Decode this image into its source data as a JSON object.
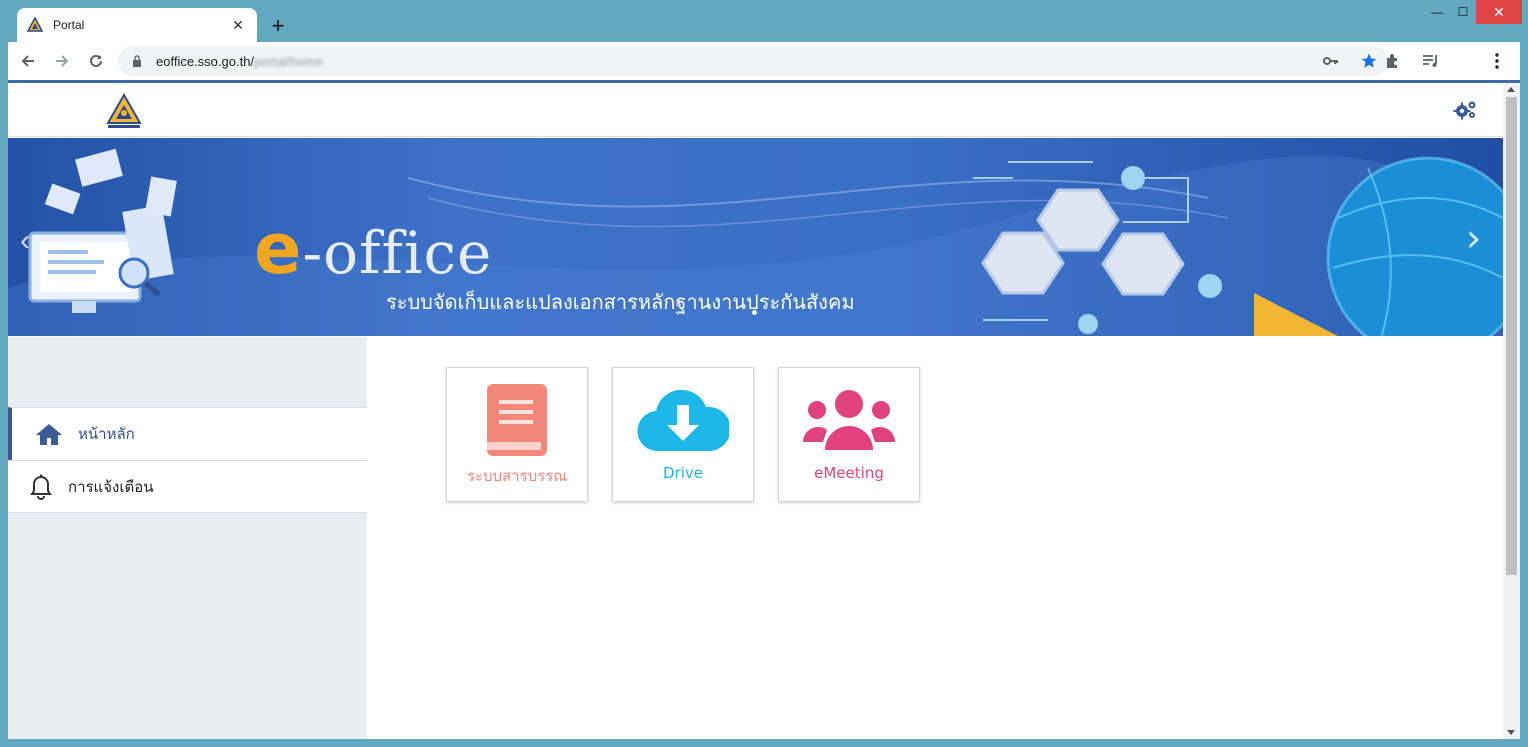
{
  "browser": {
    "tab_title": "Portal",
    "tab_close": "✕",
    "new_tab": "+",
    "url_host": "eoffice.sso.go.th/",
    "url_path": "portal/home",
    "window_controls": {
      "minimize": "—",
      "maximize": "☐",
      "close": "✕"
    },
    "colors": {
      "frame": "#62a9bf",
      "close": "#e04343",
      "star": "#1a73e8"
    },
    "icons": [
      "back-icon",
      "forward-icon",
      "reload-icon",
      "lock-icon",
      "key-icon",
      "star-icon",
      "extensions-icon",
      "media-icon",
      "menu-icon"
    ]
  },
  "site": {
    "logo_icon": "sso-logo",
    "settings_icon": "gears-icon",
    "accent": "#3a5a98"
  },
  "banner": {
    "title_e": "e",
    "title_rest": "-office",
    "subtitle": "ระบบจัดเก็บและแปลงเอกสารหลักฐานงานประกันสังคม",
    "prev": "‹",
    "next": "›"
  },
  "sidebar": {
    "items": [
      {
        "label": "หน้าหลัก",
        "icon": "home-icon",
        "active": true
      },
      {
        "label": "การแจ้งเตือน",
        "icon": "bell-icon",
        "active": false
      }
    ]
  },
  "apps": [
    {
      "label": "ระบบสารบรรณ",
      "icon": "book-icon",
      "color": "#f4867a"
    },
    {
      "label": "Drive",
      "icon": "cloud-download-icon",
      "color": "#1cb6e8"
    },
    {
      "label": "eMeeting",
      "icon": "users-icon",
      "color": "#e04280"
    }
  ]
}
